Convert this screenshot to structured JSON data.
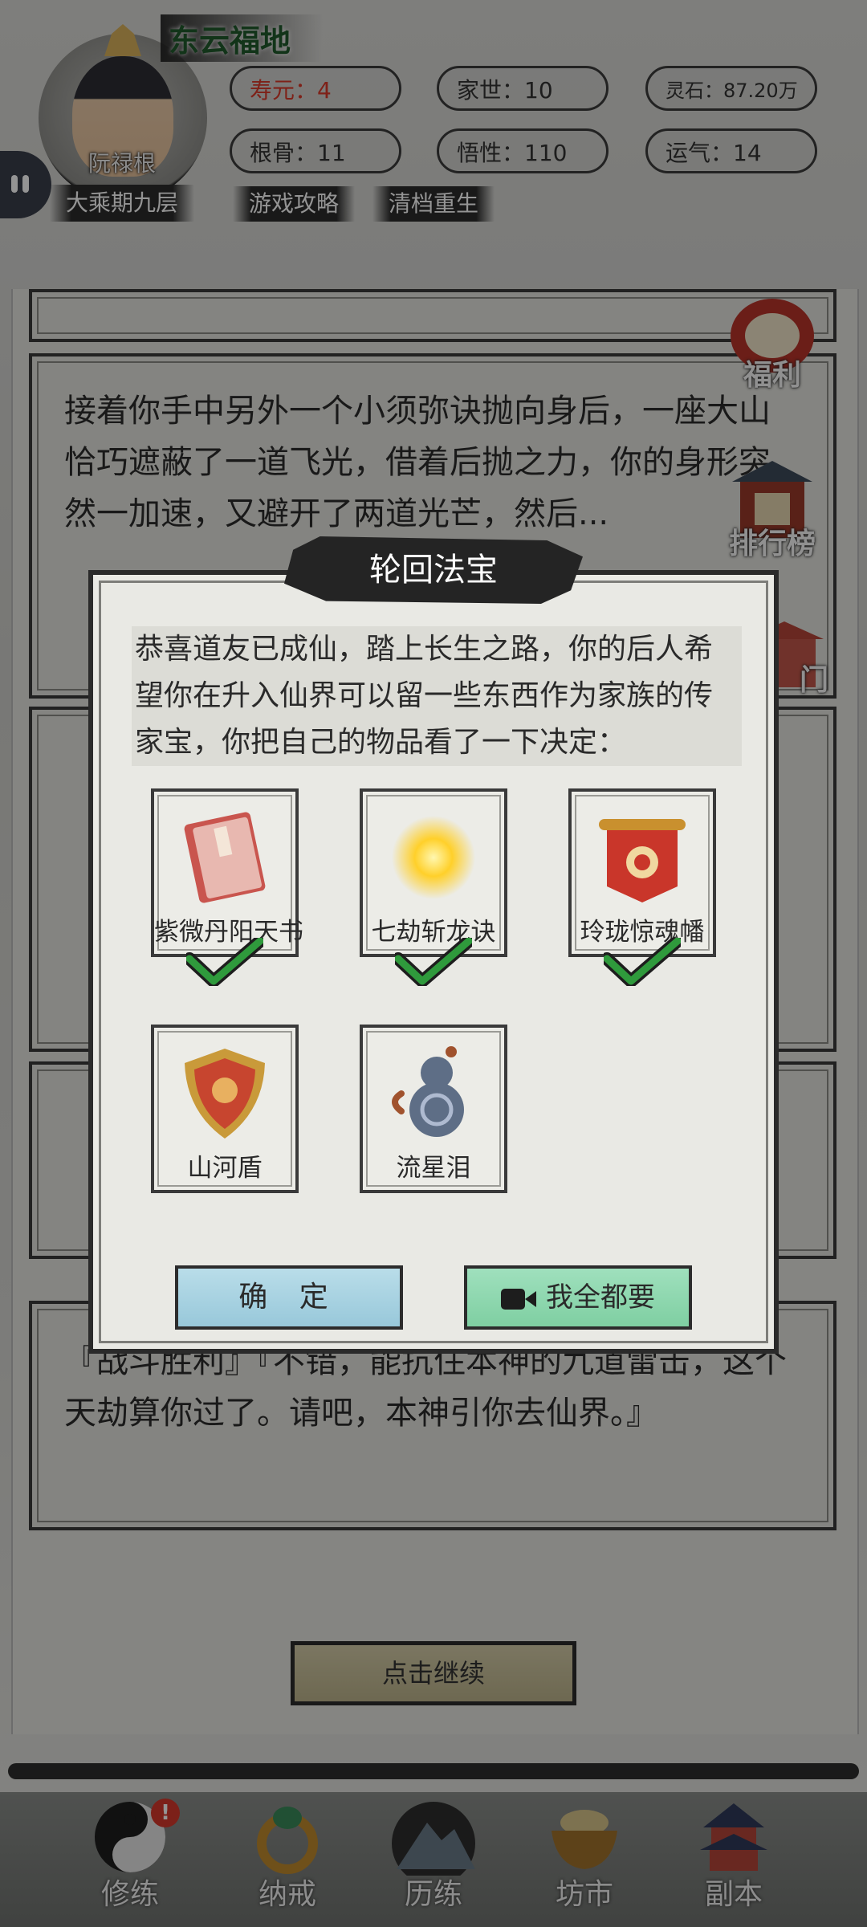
{
  "header": {
    "location": "东云福地",
    "player_name": "阮禄根",
    "realm": "大乘期九层",
    "stats": {
      "lifespan": "寿元：4",
      "family": "家世：10",
      "spirit_stones": "灵石：87.20万",
      "root_bone": "根骨：11",
      "comprehension": "悟性：110",
      "luck": "运气：14"
    },
    "links": {
      "guide": "游戏攻略",
      "reset": "清档重生"
    }
  },
  "side_buttons": {
    "welfare": "福利",
    "ranking": "排行榜",
    "sect": "门"
  },
  "story": {
    "card1_text": "接着你手中另外一个小须弥诀抛向身后，一座大山恰巧遮蔽了一道飞光，借着后抛之力，你的身形突然一加速，又避开了两道光芒，然后...",
    "card5_text": "『战斗胜利』『不错，能抗住本神的九道雷击，这个天劫算你过了。请吧，本神引你去仙界。』",
    "continue_label": "点击继续"
  },
  "dialog": {
    "title": "轮回法宝",
    "message": "恭喜道友已成仙，踏上长生之路，你的后人希望你在升入仙界可以留一些东西作为家族的传家宝，你把自己的物品看了一下决定：",
    "items": [
      {
        "name": "紫微丹阳天书",
        "selected": true,
        "icon": "book-icon"
      },
      {
        "name": "七劫斩龙诀",
        "selected": true,
        "icon": "sun-orb-icon"
      },
      {
        "name": "玲珑惊魂幡",
        "selected": true,
        "icon": "banner-icon"
      },
      {
        "name": "山河盾",
        "selected": false,
        "icon": "shield-icon"
      },
      {
        "name": "流星泪",
        "selected": false,
        "icon": "gourd-icon"
      }
    ],
    "confirm_label": "确 定",
    "take_all_label": "我全都要"
  },
  "nav": {
    "items": [
      {
        "label": "修练",
        "icon": "yin-yang-icon",
        "badge": "!"
      },
      {
        "label": "纳戒",
        "icon": "ring-icon"
      },
      {
        "label": "历练",
        "icon": "mountain-icon"
      },
      {
        "label": "坊市",
        "icon": "cauldron-icon"
      },
      {
        "label": "副本",
        "icon": "pagoda-icon"
      }
    ]
  },
  "colors": {
    "confirm_button": "#98c8da",
    "take_all_button": "#7fcfa2",
    "check_green": "#2f9a3c",
    "lifespan_red": "#d93a2a"
  }
}
